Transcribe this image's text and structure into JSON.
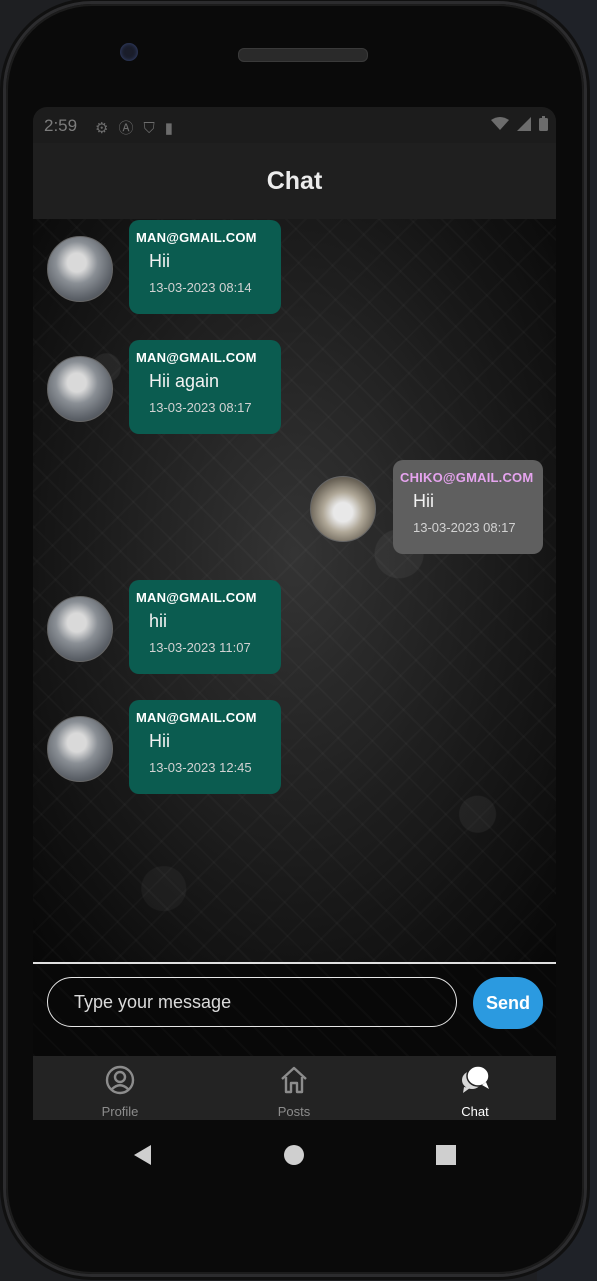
{
  "status_bar": {
    "time": "2:59",
    "left_icons": [
      "gear-icon",
      "a-circle-icon",
      "shield-icon",
      "sd-card-icon"
    ],
    "right_icons": [
      "wifi-icon",
      "signal-icon",
      "battery-icon"
    ]
  },
  "app_bar": {
    "title": "Chat"
  },
  "messages": [
    {
      "sender": "MAN@GMAIL.COM",
      "text": "Hii",
      "time": "13-03-2023 08:14",
      "mine": true
    },
    {
      "sender": "MAN@GMAIL.COM",
      "text": "Hii again",
      "time": "13-03-2023 08:17",
      "mine": true
    },
    {
      "sender": "CHIKO@GMAIL.COM",
      "text": "Hii",
      "time": "13-03-2023 08:17",
      "mine": false
    },
    {
      "sender": "MAN@GMAIL.COM",
      "text": "hii",
      "time": "13-03-2023 11:07",
      "mine": true
    },
    {
      "sender": "MAN@GMAIL.COM",
      "text": "Hii",
      "time": "13-03-2023 12:45",
      "mine": true
    }
  ],
  "composer": {
    "placeholder": "Type your message",
    "send_label": "Send"
  },
  "bottom_nav": {
    "items": [
      {
        "label": "Profile",
        "icon": "profile-icon",
        "active": false
      },
      {
        "label": "Posts",
        "icon": "home-icon",
        "active": false
      },
      {
        "label": "Chat",
        "icon": "chat-icon",
        "active": true
      }
    ]
  },
  "system_nav": {
    "icons": [
      "back-icon",
      "home-circle-icon",
      "recents-icon"
    ]
  },
  "colors": {
    "bubble_mine": "#0b5c50",
    "bubble_other": "#5f5f5f",
    "sender_other": "#e6a4ef",
    "send_button": "#2b9ae0",
    "app_bar": "#1f1f1f"
  }
}
